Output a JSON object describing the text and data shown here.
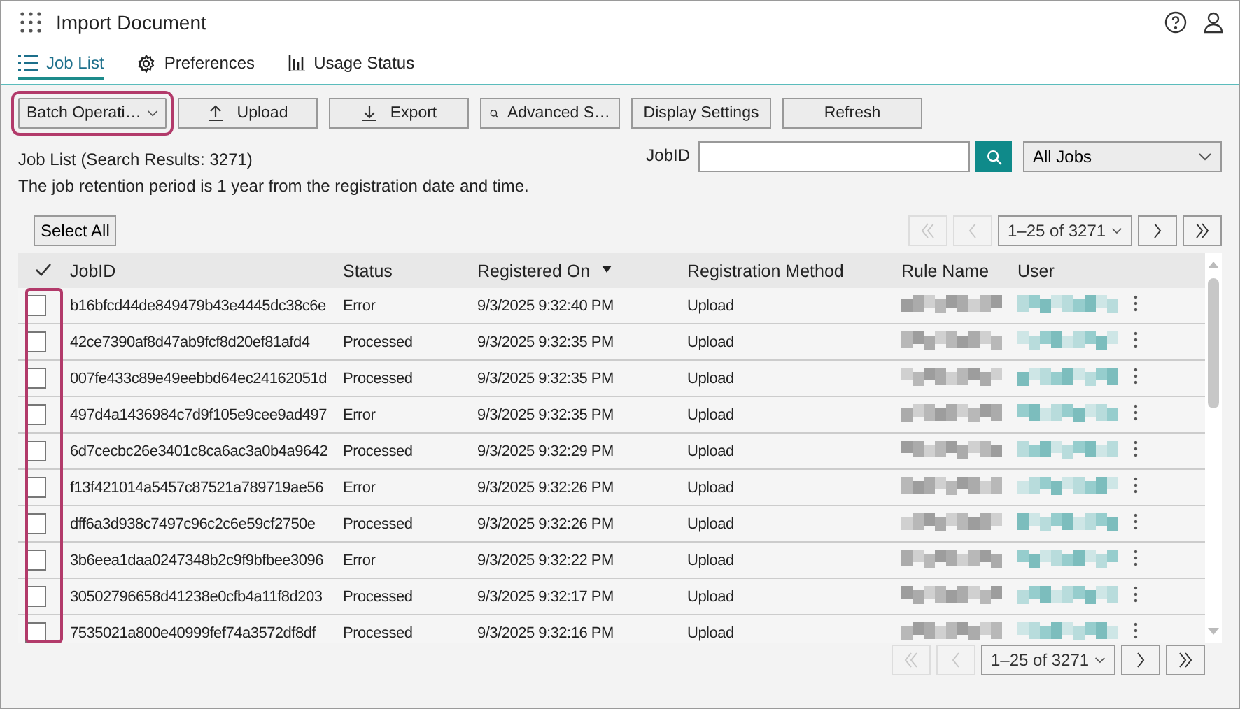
{
  "window": {
    "title": "Import Document"
  },
  "tabs": [
    {
      "label": "Job List",
      "selected": true
    },
    {
      "label": "Preferences",
      "selected": false
    },
    {
      "label": "Usage Status",
      "selected": false
    }
  ],
  "toolbar": [
    {
      "label": "Batch Operati…",
      "kind": "dropdown",
      "highlighted": true
    },
    {
      "label": "Upload",
      "kind": "upload",
      "highlighted": false
    },
    {
      "label": "Export",
      "kind": "export",
      "highlighted": false
    },
    {
      "label": "Advanced S…",
      "kind": "search",
      "highlighted": false
    },
    {
      "label": "Display Settings",
      "kind": "plain",
      "highlighted": false
    },
    {
      "label": "Refresh",
      "kind": "plain",
      "highlighted": false
    }
  ],
  "summary": "Job List (Search Results: 3271)",
  "notice": "The job retention period is 1 year from the registration date and time.",
  "filter": {
    "label": "JobID",
    "filter_select": "All Jobs"
  },
  "select_all": "Select All",
  "pager": {
    "range": "1–25 of 3271",
    "first_disabled": true,
    "prev_disabled": true
  },
  "bottom_pager": {
    "range": "1–25 of 3271",
    "first_disabled": true,
    "prev_disabled": true
  },
  "table": {
    "checkbox_column_highlighted": true,
    "columns": [
      {
        "label": "JobID",
        "sorted": false
      },
      {
        "label": "Status",
        "sorted": false
      },
      {
        "label": "Registered On",
        "sorted": true
      },
      {
        "label": "Registration Method",
        "sorted": false
      },
      {
        "label": "Rule Name",
        "sorted": false
      },
      {
        "label": "User",
        "sorted": false
      }
    ],
    "rows": [
      {
        "job_id": "b16bfcd44de849479b43e4445dc38c6e",
        "status": "Error",
        "registered_on": "9/3/2025 9:32:40 PM",
        "method": "Upload",
        "checked": false
      },
      {
        "job_id": "42ce7390af8d47ab9fcf8d20ef81afd4",
        "status": "Processed",
        "registered_on": "9/3/2025 9:32:35 PM",
        "method": "Upload",
        "checked": false
      },
      {
        "job_id": "007fe433c89e49eebbd64ec24162051d",
        "status": "Processed",
        "registered_on": "9/3/2025 9:32:35 PM",
        "method": "Upload",
        "checked": false
      },
      {
        "job_id": "497d4a1436984c7d9f105e9cee9ad497",
        "status": "Error",
        "registered_on": "9/3/2025 9:32:35 PM",
        "method": "Upload",
        "checked": false
      },
      {
        "job_id": "6d7cecbc26e3401c8ca6ac3a0b4a9642",
        "status": "Processed",
        "registered_on": "9/3/2025 9:32:29 PM",
        "method": "Upload",
        "checked": false
      },
      {
        "job_id": "f13f421014a5457c87521a789719ae56",
        "status": "Error",
        "registered_on": "9/3/2025 9:32:26 PM",
        "method": "Upload",
        "checked": false
      },
      {
        "job_id": "dff6a3d938c7497c96c2c6e59cf2750e",
        "status": "Processed",
        "registered_on": "9/3/2025 9:32:26 PM",
        "method": "Upload",
        "checked": false
      },
      {
        "job_id": "3b6eea1daa0247348b2c9f9bfbee3096",
        "status": "Error",
        "registered_on": "9/3/2025 9:32:22 PM",
        "method": "Upload",
        "checked": false
      },
      {
        "job_id": "30502796658d41238e0cfb4a11f8d203",
        "status": "Processed",
        "registered_on": "9/3/2025 9:32:17 PM",
        "method": "Upload",
        "checked": false
      },
      {
        "job_id": "7535021a800e40999fef74a3572df8df",
        "status": "Processed",
        "registered_on": "9/3/2025 9:32:16 PM",
        "method": "Upload",
        "checked": false
      }
    ]
  }
}
